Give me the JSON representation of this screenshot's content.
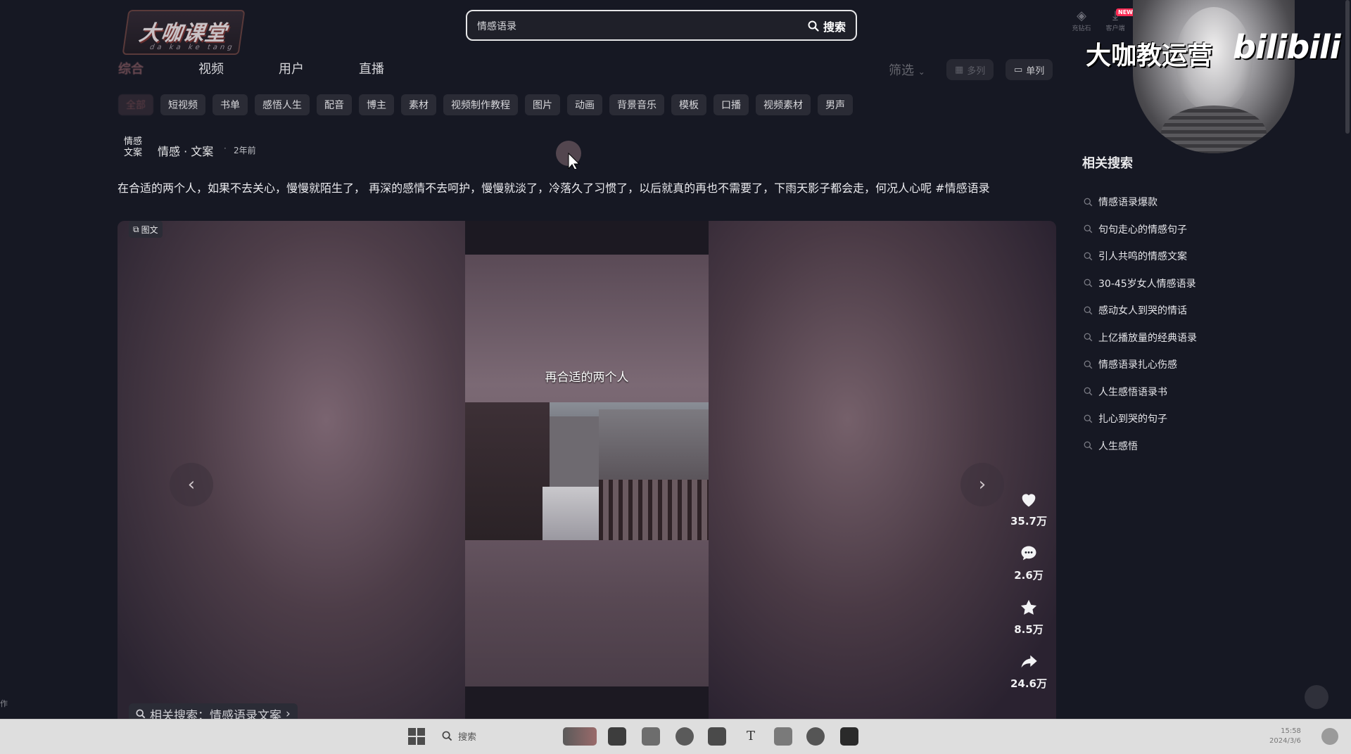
{
  "logo": {
    "main": "大咖课堂",
    "sub": "da ka ke tang"
  },
  "search": {
    "value": "情感语录",
    "button_label": "搜索"
  },
  "header_icons": [
    {
      "name": "diamond-icon",
      "label": "充钻石"
    },
    {
      "name": "download-icon",
      "label": "客户端"
    }
  ],
  "header_badge": "NEW",
  "tabs": [
    {
      "label": "综合",
      "active": true
    },
    {
      "label": "视频",
      "active": false
    },
    {
      "label": "用户",
      "active": false
    },
    {
      "label": "直播",
      "active": false
    }
  ],
  "toolbar": {
    "filter_label": "筛选",
    "multi_label": "多列",
    "single_label": "单列"
  },
  "chips": [
    "全部",
    "短视频",
    "书单",
    "感悟人生",
    "配音",
    "博主",
    "素材",
    "视频制作教程",
    "图片",
    "动画",
    "背景音乐",
    "模板",
    "口播",
    "视频素材",
    "男声"
  ],
  "post": {
    "avatar_text": "情感 文案",
    "author": "情感 · 文案",
    "time": "2年前",
    "caption": "在合适的两个人，如果不去关心，慢慢就陌生了， 再深的感情不去呵护，慢慢就淡了，冷落久了习惯了，以后就真的再也不需要了，下雨天影子都会走，何况人心呢 #情感语录",
    "type_badge": "图文",
    "slide_text": "再合适的两个人",
    "likes": "35.7万",
    "comments": "2.6万",
    "favorites": "8.5万",
    "shares": "24.6万",
    "related_bottom": "相关搜索：情感语录文案"
  },
  "related": {
    "title": "相关搜索",
    "items": [
      "情感语录爆款",
      "句句走心的情感句子",
      "引人共鸣的情感文案",
      "30-45岁女人情感语录",
      "感动女人到哭的情话",
      "上亿播放量的经典语录",
      "情感语录扎心伤感",
      "人生感悟语录书",
      "扎心到哭的句子",
      "人生感悟"
    ]
  },
  "overlay": {
    "title": "大咖教运营",
    "brand": "bilibili"
  },
  "edge_text": "作",
  "taskbar": {
    "search_label": "搜索",
    "time": "15:58",
    "date": "2024/3/6"
  },
  "colors": {
    "background": "#161823",
    "chip": "#2a2b35",
    "accent": "#fe2c55"
  }
}
